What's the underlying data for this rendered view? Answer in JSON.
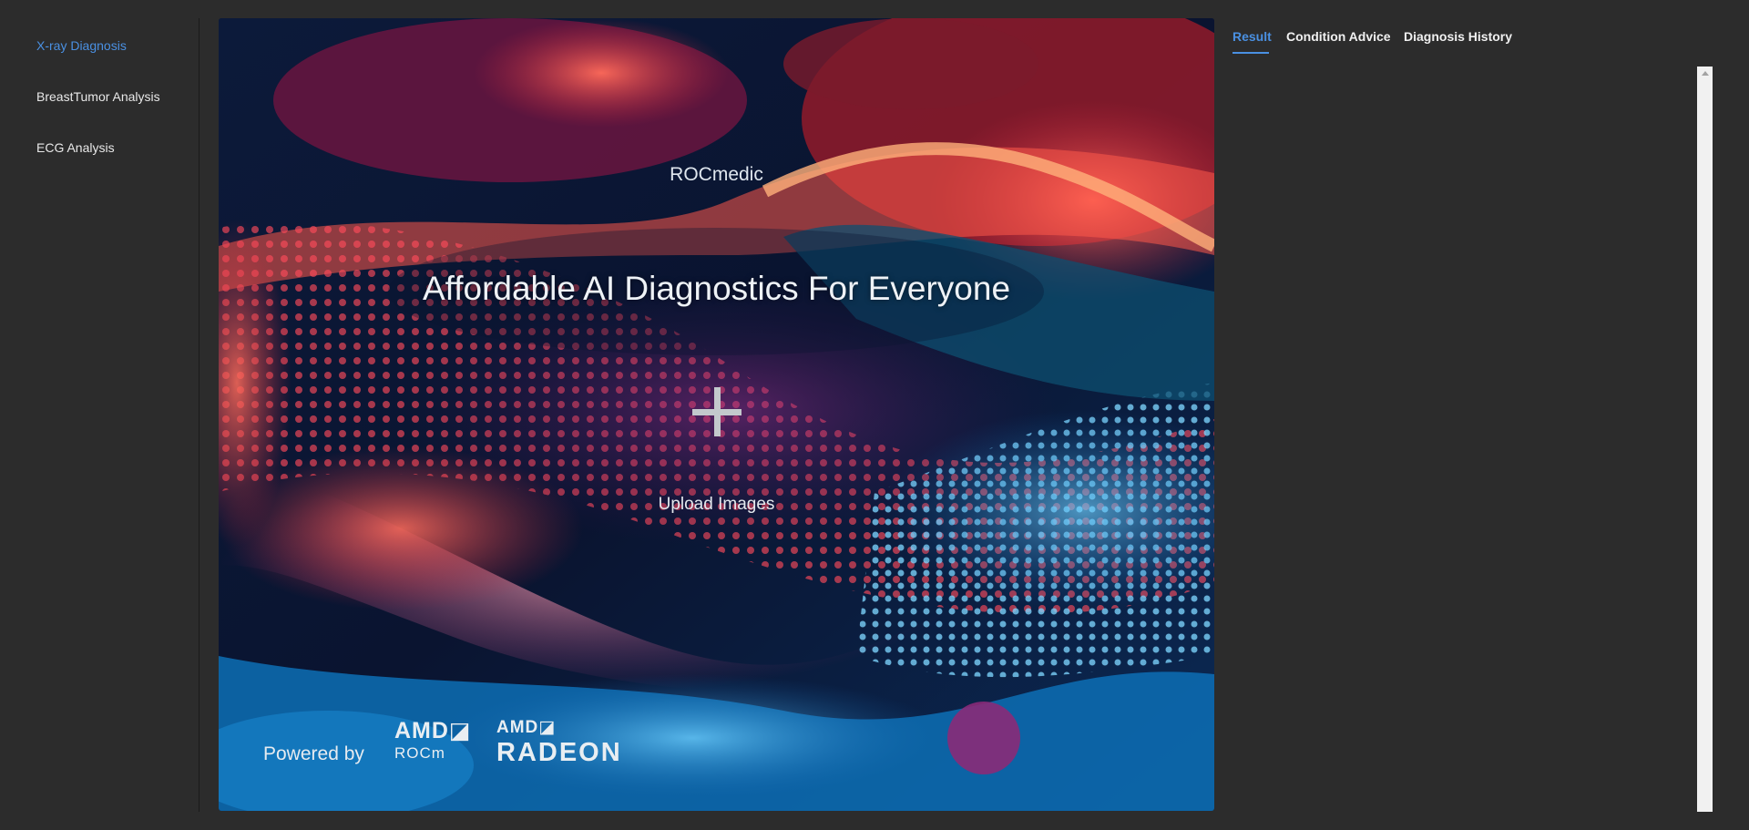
{
  "sidebar": {
    "items": [
      {
        "label": "X-ray Diagnosis",
        "active": true
      },
      {
        "label": "BreastTumor Analysis",
        "active": false
      },
      {
        "label": "ECG Analysis",
        "active": false
      }
    ]
  },
  "hero": {
    "brand": "ROCmedic",
    "title": "Affordable AI Diagnostics For Everyone",
    "upload_icon": "plus-icon",
    "upload_label": "Upload Images",
    "powered_by": "Powered by",
    "logo_rocm": {
      "amd": "AMD◪",
      "product": "ROCm"
    },
    "logo_radeon": {
      "amd": "AMD◪",
      "product": "RADEON"
    }
  },
  "tabs": [
    {
      "label": "Result",
      "active": true
    },
    {
      "label": "Condition Advice",
      "active": false
    },
    {
      "label": "Diagnosis History",
      "active": false
    }
  ],
  "colors": {
    "background": "#2c2c2c",
    "accent": "#4a90e2",
    "text": "#e8e8e8",
    "scrollbar": "#f1f1f1"
  }
}
